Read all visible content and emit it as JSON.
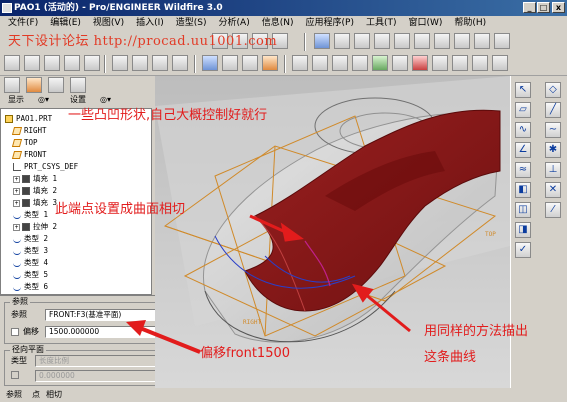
{
  "window": {
    "title": "PAO1 (活动的) - Pro/ENGINEER Wildfire 3.0",
    "min_label": "_",
    "max_label": "□",
    "close_label": "x"
  },
  "menu": [
    "文件(F)",
    "编辑(E)",
    "视图(V)",
    "插入(I)",
    "造型(S)",
    "分析(A)",
    "信息(N)",
    "应用程序(P)",
    "工具(T)",
    "窗口(W)",
    "帮助(H)"
  ],
  "watermark": "天下设计论坛  http://procad.uu1001.com",
  "panel": {
    "show_label": "显示",
    "settings_label": "设置"
  },
  "tree": [
    {
      "label": "PAO1.PRT",
      "icon": "part",
      "indent": 0
    },
    {
      "label": "RIGHT",
      "icon": "plane",
      "indent": 1
    },
    {
      "label": "TOP",
      "icon": "plane",
      "indent": 1
    },
    {
      "label": "FRONT",
      "icon": "plane",
      "indent": 1
    },
    {
      "label": "PRT_CSYS_DEF",
      "icon": "csys",
      "indent": 1
    },
    {
      "label": "填充 1",
      "icon": "solid",
      "indent": 1,
      "expand": true
    },
    {
      "label": "填充 2",
      "icon": "solid",
      "indent": 1,
      "expand": true
    },
    {
      "label": "填充 3",
      "icon": "solid",
      "indent": 1,
      "expand": true
    },
    {
      "label": "类型 1",
      "icon": "curve",
      "indent": 1
    },
    {
      "label": "拉伸 2",
      "icon": "solid",
      "indent": 1,
      "expand": true
    },
    {
      "label": "类型 2",
      "icon": "curve",
      "indent": 1
    },
    {
      "label": "类型 3",
      "icon": "curve",
      "indent": 1
    },
    {
      "label": "类型 4",
      "icon": "curve",
      "indent": 1
    },
    {
      "label": "类型 5",
      "icon": "curve",
      "indent": 1
    },
    {
      "label": "类型 6",
      "icon": "curve",
      "indent": 1
    }
  ],
  "ref": {
    "group_label": "参照",
    "ref_label": "参照",
    "ref_value": "FRONT:F3(基准平面)",
    "offset_label": "偏移",
    "offset_value": "1500.000000",
    "radial_group_label": "径向平面",
    "type_label": "类型",
    "type_value": "长度比例",
    "dim_value": "0.000000"
  },
  "bottom_tabs": [
    "参照",
    "点",
    "相切"
  ],
  "viewport": {
    "label_right": "RIGHT",
    "label_top": "TOP"
  },
  "annotations": {
    "a1": "一些凸凹形状,自己大概控制好就行",
    "a2": "此端点设置成曲面相切",
    "a3": "用同样的方法描出",
    "a4": "这条曲线",
    "a5": "偏移front1500"
  },
  "colors": {
    "surface_red": "#8b1a1a",
    "datum_orange": "#d08a2a",
    "annotation_red": "#e21c1c",
    "watermark_red": "#e23a25"
  }
}
